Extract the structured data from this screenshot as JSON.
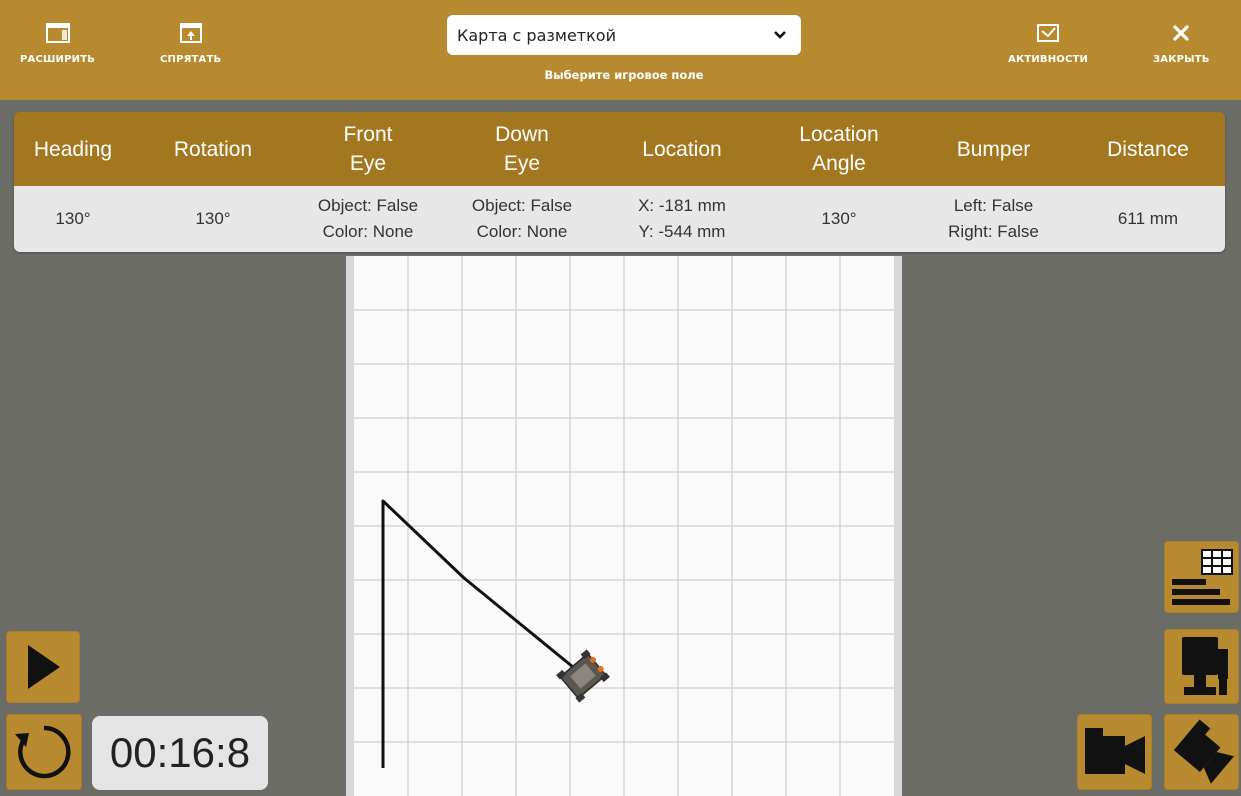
{
  "toolbar": {
    "expand_label": "РАСШИРИТЬ",
    "hide_label": "СПРЯТАТЬ",
    "field_select_value": "Карта с разметкой",
    "field_select_hint": "Выберите игровое поле",
    "activities_label": "АКТИВНОСТИ",
    "close_label": "ЗАКРЫТЬ"
  },
  "telemetry": {
    "headers": {
      "heading": "Heading",
      "rotation": "Rotation",
      "front_eye_1": "Front",
      "front_eye_2": "Eye",
      "down_eye_1": "Down",
      "down_eye_2": "Eye",
      "location": "Location",
      "location_angle_1": "Location",
      "location_angle_2": "Angle",
      "bumper": "Bumper",
      "distance": "Distance"
    },
    "values": {
      "heading": "130°",
      "rotation": "130°",
      "front_eye_object": "Object: False",
      "front_eye_color": "Color: None",
      "down_eye_object": "Object: False",
      "down_eye_color": "Color: None",
      "location_x": "X: -181 mm",
      "location_y": "Y: -544 mm",
      "location_angle": "130°",
      "bumper_left": "Left: False",
      "bumper_right": "Right: False",
      "distance": "611 mm"
    }
  },
  "timer": {
    "value": "00:16:8"
  },
  "icons": {
    "expand": "expand-window-icon",
    "hide": "hide-window-icon",
    "activities": "activities-checkbox-icon",
    "close": "close-icon",
    "select_arrow": "chevron-down-icon",
    "play": "play-icon",
    "reset": "reset-icon",
    "sensor_table": "sensor-table-icon",
    "robot_camera": "robot-camera-icon",
    "camera": "video-camera-icon",
    "top_camera": "overhead-camera-icon"
  },
  "colors": {
    "toolbar": "#b88a30",
    "table_header": "#a37620",
    "background": "#6c6c66",
    "path": "#111111"
  }
}
